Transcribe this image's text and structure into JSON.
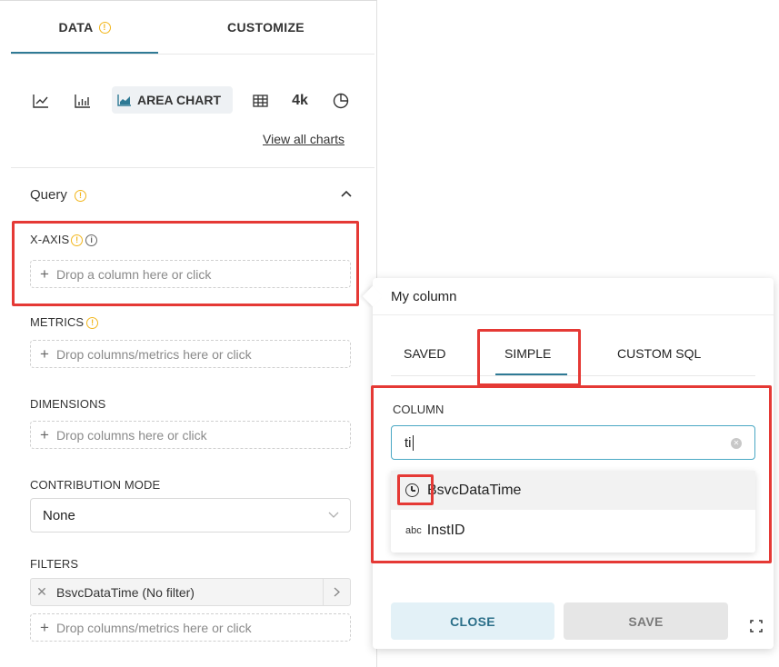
{
  "tabs": {
    "data_label": "DATA",
    "customize_label": "CUSTOMIZE",
    "data_warning": "!"
  },
  "chart_types": {
    "icons": [
      "line-chart-icon",
      "bar-chart-icon",
      "area-chart-icon",
      "table-icon",
      "big-number-icon",
      "pie-chart-icon"
    ],
    "selected_label": "AREA CHART",
    "big_number_label": "4k",
    "view_all": "View all charts"
  },
  "query": {
    "title": "Query",
    "title_warning": "!",
    "x_axis": {
      "label": "X-AXIS",
      "warning": "!",
      "info": "i",
      "placeholder": "Drop a column here or click"
    },
    "metrics": {
      "label": "METRICS",
      "warning": "!",
      "placeholder": "Drop columns/metrics here or click"
    },
    "dimensions": {
      "label": "DIMENSIONS",
      "placeholder": "Drop columns here or click"
    },
    "contribution": {
      "label": "CONTRIBUTION MODE",
      "value": "None"
    },
    "filters": {
      "label": "FILTERS",
      "chip": "BsvcDataTime (No filter)",
      "placeholder": "Drop columns/metrics here or click"
    }
  },
  "popover": {
    "title": "My column",
    "tabs": [
      "SAVED",
      "SIMPLE",
      "CUSTOM SQL"
    ],
    "active_tab": "SIMPLE",
    "column_label": "COLUMN",
    "search_value": "ti",
    "options": [
      {
        "type_icon": "clock-icon",
        "label": "BsvcDataTime"
      },
      {
        "type_icon": "abc",
        "label": "InstID"
      }
    ],
    "close_label": "CLOSE",
    "save_label": "SAVE"
  },
  "colors": {
    "accent": "#2f7a95",
    "highlight": "#e53935",
    "warning": "#f2b61c",
    "close_bg": "#e3f1f7",
    "save_bg": "#e6e6e6"
  }
}
